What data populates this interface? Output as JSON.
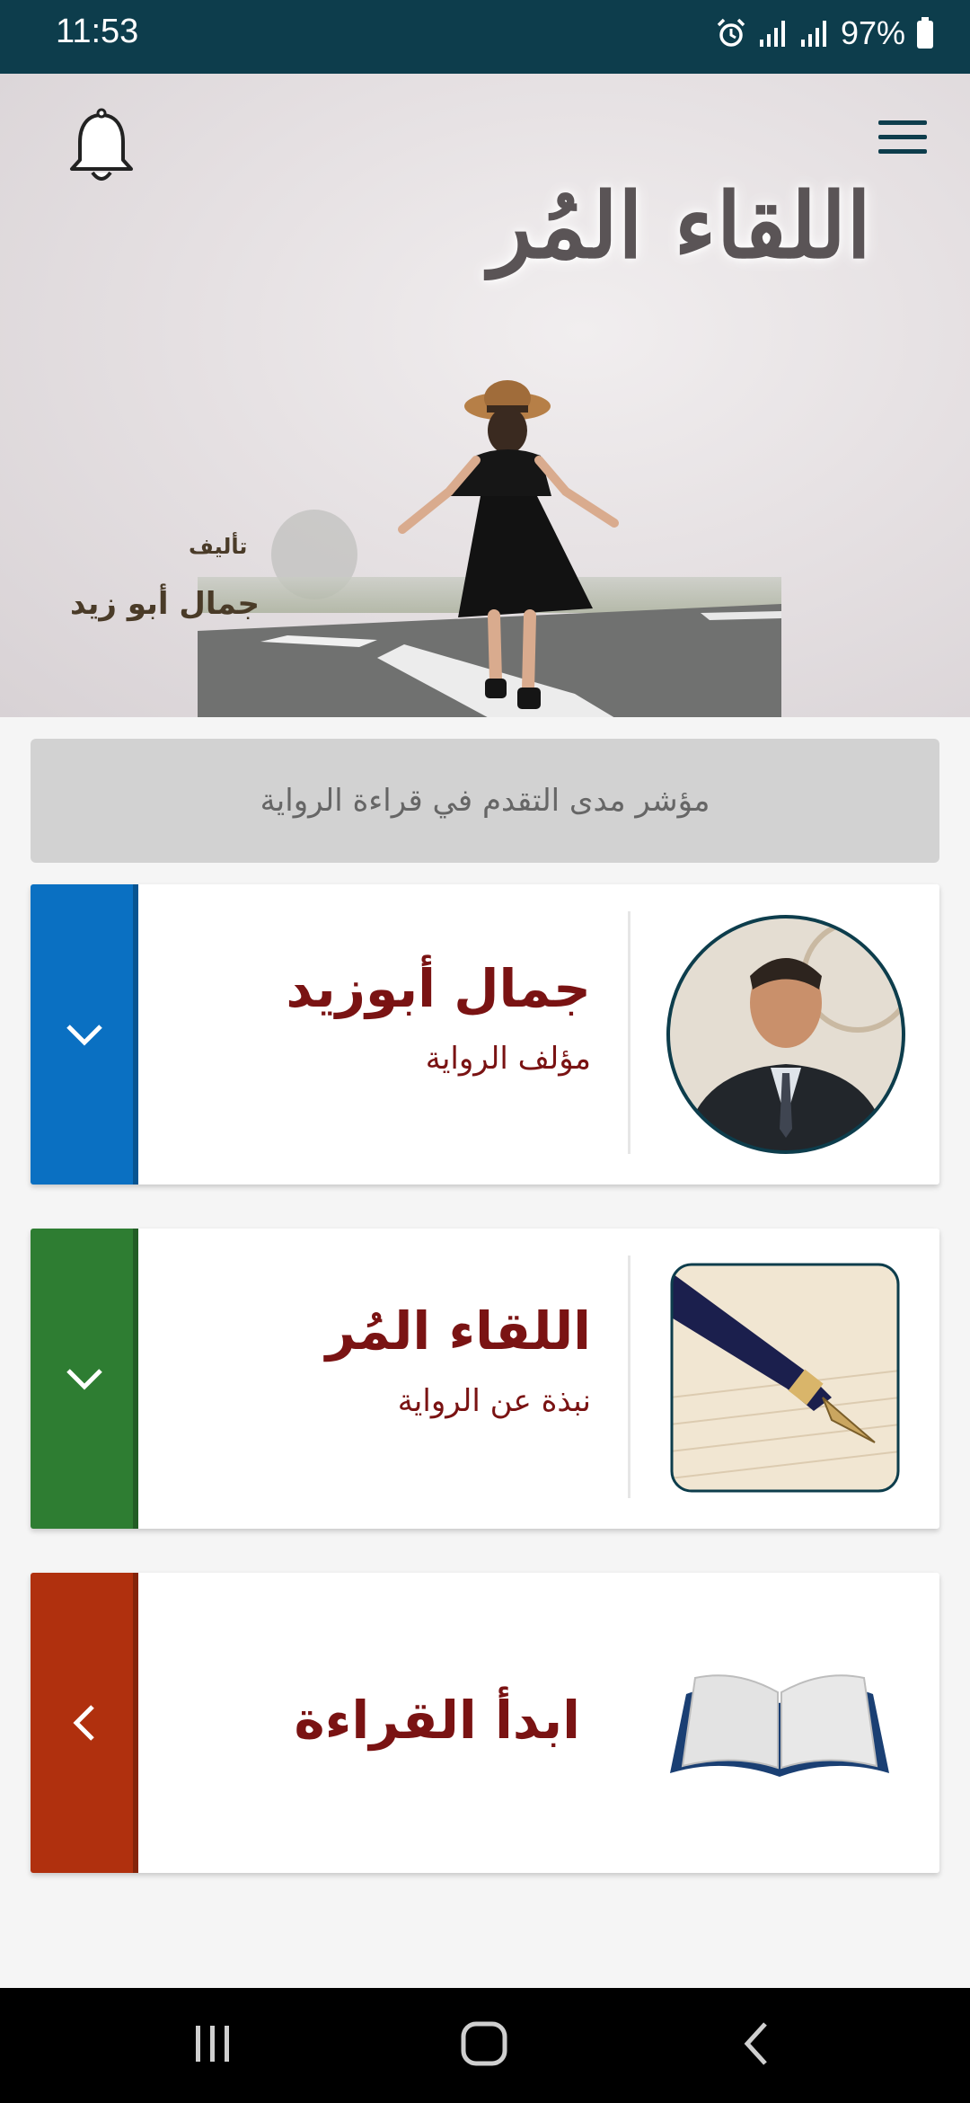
{
  "status_bar": {
    "time": "11:53",
    "battery_text": "97%",
    "icons": [
      "alarm-icon",
      "signal-icon",
      "signal-icon",
      "battery-icon"
    ]
  },
  "hero": {
    "title": "اللقاء المُر",
    "by_label": "تأليف",
    "author": "جمال أبو زيد",
    "menu_icon": "menu-icon",
    "bell_icon": "bell-icon"
  },
  "progress": {
    "label": "مؤشر مدى التقدم في قراءة الرواية",
    "value_percent": 0
  },
  "cards": [
    {
      "title": "جمال أبوزيد",
      "subtitle": "مؤلف الرواية",
      "strip_color": "#0a70c2",
      "action_icon": "chevron-down-icon",
      "photo_icon": "author-portrait"
    },
    {
      "title": "اللقاء المُر",
      "subtitle": "نبذة عن الرواية",
      "strip_color": "#2e7d32",
      "action_icon": "chevron-down-icon",
      "photo_icon": "fountain-pen-image"
    },
    {
      "title": "ابدأ القراءة",
      "subtitle": "",
      "strip_color": "#b0300e",
      "action_icon": "chevron-left-icon",
      "photo_icon": "open-book-icon"
    }
  ],
  "colors": {
    "primary_dark": "#0d3d4c",
    "title_red": "#7a1313",
    "progress_bg": "#d2d2d2"
  },
  "nav_bar": {
    "icons": [
      "recent-apps-icon",
      "home-icon",
      "back-icon"
    ]
  }
}
